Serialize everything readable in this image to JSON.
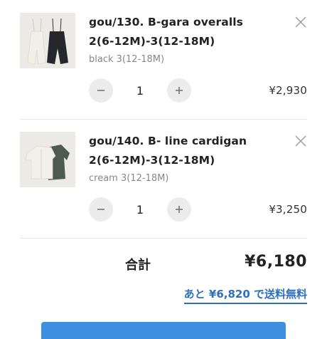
{
  "cart": {
    "items": [
      {
        "title": "gou/130. B-gara overalls 2(6-12M)-3(12-18M)",
        "variant": "black 3(12-18M)",
        "quantity": "1",
        "price": "¥2,930",
        "image_icon": "overalls-product-image"
      },
      {
        "title": "gou/140. B- line cardigan 2(6-12M)-3(12-18M)",
        "variant": "cream 3(12-18M)",
        "quantity": "1",
        "price": "¥3,250",
        "image_icon": "cardigan-product-image"
      }
    ],
    "total_label": "合計",
    "total_value": "¥6,180",
    "free_shipping_text": "あと ¥6,820 で送料無料",
    "colors": {
      "accent": "#2f6fc0",
      "button": "#3d8fe0",
      "stepper": "#ececec"
    },
    "icons": {
      "minus": "minus-icon",
      "plus": "plus-icon",
      "remove": "close-icon"
    }
  }
}
